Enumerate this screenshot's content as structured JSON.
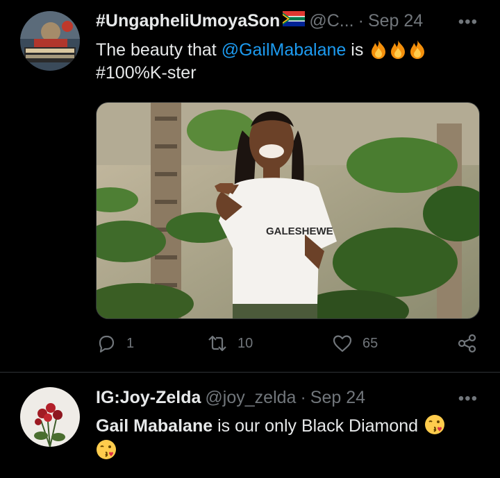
{
  "tweet1": {
    "display_name": "#UngapheliUmoyaSon",
    "handle": "@C...",
    "dot": "·",
    "date": "Sep 24",
    "more": "•••",
    "text_prefix": "The beauty that ",
    "mention": "@GailMabalane",
    "text_mid": " is ",
    "text_line2": "#100%K-ster",
    "emoji_icons": [
      "fire-emoji",
      "fire-emoji",
      "fire-emoji"
    ],
    "flag_icon": "south-africa-flag",
    "shirt_text": "GALESHEWE",
    "stats": {
      "replies": "1",
      "retweets": "10",
      "likes": "65"
    }
  },
  "tweet2": {
    "display_name": "IG:Joy-Zelda",
    "handle": "@joy_zelda",
    "dot": "·",
    "date": "Sep 24",
    "more": "•••",
    "text_bold": "Gail Mabalane",
    "text_rest": " is our only Black Diamond ",
    "emoji_icons": [
      "kiss-wink-emoji",
      "kiss-wink-emoji"
    ]
  },
  "colors": {
    "background": "#000000",
    "text": "#e7e9ea",
    "secondary": "#71767b",
    "link": "#1d9bf0",
    "divider": "#2f3336"
  }
}
